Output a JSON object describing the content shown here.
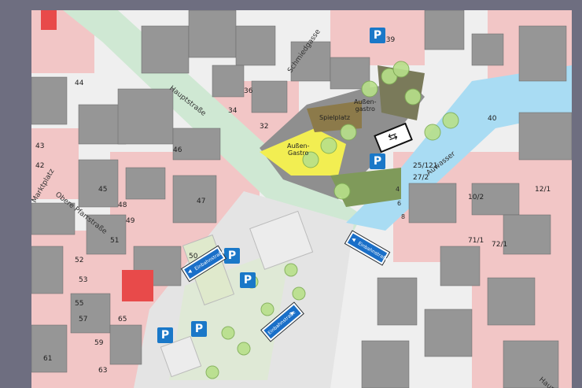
{
  "map": {
    "streets": {
      "hauptstrasse": "Hauptstraße",
      "obere_pfarrstrasse": "Obere Pfarrstraße",
      "marktplatz": "Marktplatz",
      "schmiedgasse": "Schmiedgasse",
      "auwasser": "Auwasser",
      "hauptstr_lower": "Hauptstr."
    },
    "areas": {
      "spielplatz": "Spielplatz",
      "aussengastro_1": "Außen-\ngastro",
      "aussengastro_2": "Außen-\nGastro"
    },
    "signs": {
      "parking": "P",
      "twoway": "⇆",
      "einbahn_label": "Einbahnstraße"
    },
    "plot_numbers": [
      "44",
      "43",
      "42",
      "45",
      "46",
      "47",
      "48",
      "49",
      "50",
      "51",
      "52",
      "53",
      "55",
      "57",
      "59",
      "61",
      "63",
      "65",
      "10/2",
      "71/1",
      "72/1",
      "12/1",
      "40",
      "36",
      "34",
      "32",
      "27/2",
      "25/1",
      "21",
      "139",
      "4",
      "6",
      "8"
    ],
    "colors": {
      "water": "#a9dcf3",
      "plaza_yellow": "#f2ee52",
      "road_green": "#cfe8d3",
      "building_gray": "#969696",
      "building_pink": "#f2c6c6",
      "building_red": "#e84a4a",
      "parking_blue": "#1a78c8",
      "tree_green": "#b8e08a"
    }
  }
}
